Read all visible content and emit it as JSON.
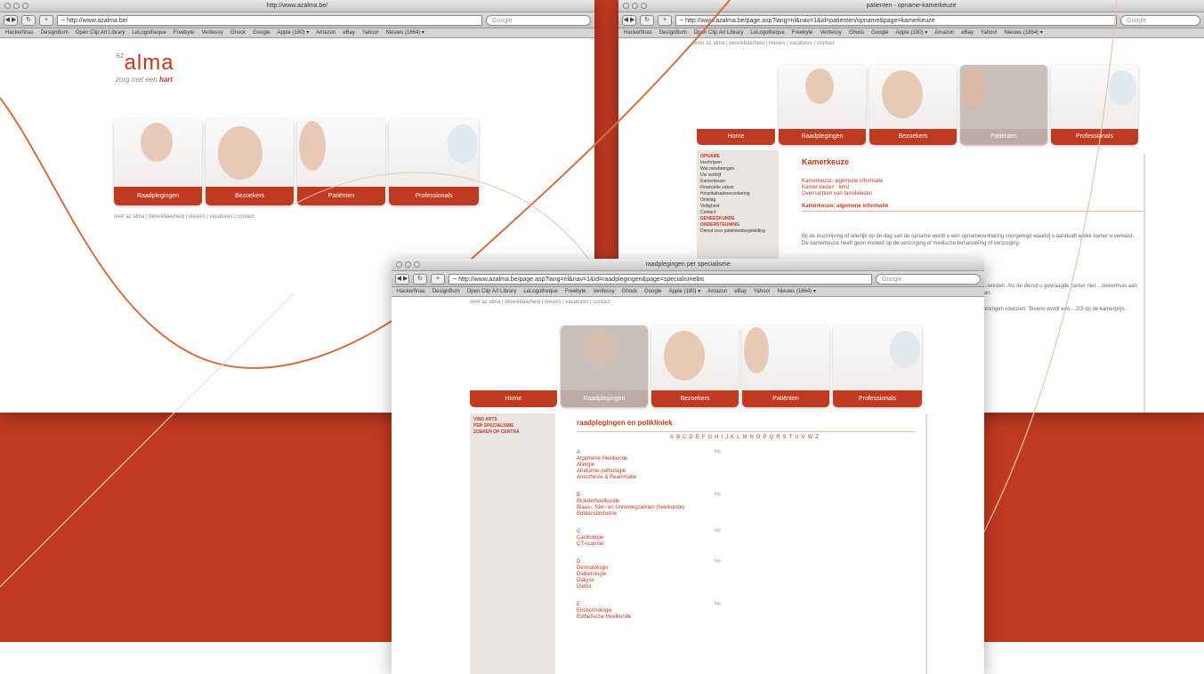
{
  "colors": {
    "accent": "#c03a22",
    "background_red": "#c03a22",
    "tab_dim": "#bcaaa4"
  },
  "bookmarks": [
    "Hackerfinas",
    "DesignBum",
    "Open Clip Art Library",
    "LeLogotheque",
    "Freebyte",
    "Veritessy",
    "Ghock",
    "Google",
    "Apple (180) ▾",
    "Amazon",
    "eBay",
    "Yahoo!",
    "Nieuws (1864) ▾"
  ],
  "search_placeholder": "Google",
  "site": {
    "logo_prefix": "az",
    "logo_name": "alma",
    "slogan_prefix": "zorg met een",
    "slogan_accent": "hart",
    "top_links": "over az alma  |  bereikbaarheid  |  nieuws  |  vacatures  |  contact"
  },
  "window1": {
    "title": "http://www.azalma.be/",
    "url": "http://www.azalma.be/",
    "tabs": [
      "Raadplegingen",
      "Bezoekers",
      "Patiënten",
      "Professionals"
    ]
  },
  "window2": {
    "title": "patienten - opname-kamerkeuze",
    "url": "http://www.azalma.be/page.asp?lang=nl&nav=1&id=patienten/opname&page=kamerkeuze",
    "tabs": [
      "Home",
      "Raadplegingen",
      "Bezoekers",
      "Patiënten",
      "Professionals"
    ],
    "sidebar": [
      "OPNAME",
      "Inschrijven",
      "Wat meebrengen",
      "Uw verblijf",
      "Kamerkeuze",
      "Financiële zaken",
      "Hospitalisatieverzekering",
      "Ontslag",
      "Veiligheid",
      "Contact",
      "GENEESKUNDE",
      "ONDERSTEUNING",
      "Dienst voor patiëntenbegeleiding"
    ],
    "heading": "Kamerkeuze",
    "links": [
      "Kamerkeuze: algemene informatie",
      "Kamer kiezen : kmd",
      "Overnachten van familieleden"
    ],
    "subheading": "Kamerkeuze: algemene informatie",
    "paragraph": "Bij de inschrijving of uiterlijk op de dag van de opname wordt u een opnameverklaring voorgelegd waarbij u aanduidt welke kamer u verkiest. De kamerkeuze heeft geen invloed op de verzorging of medische behandeling of verzorging.",
    "paragraph2": "...bespreekt u in het patiëntenverblijf. Kamerbezoek ligt in de campus Eeklo. ...worden. Als de dienst u gevraagde kamer niet ...ziekenhuis aan de prijzen zijn u bij opname ...kamer ...kunt. ...aan de kamer en ...het alweg aan.",
    "paragraph3": "...Kosten en behandeling hebben ook erelonen. Voor het verblijf ...tegemoetkomingen voorzien. Tevens wordt een ...2/3 op de kamerprijs.",
    "paragraph4": "...wordt een verblijf op een"
  },
  "window3": {
    "title": "raadplegingen per specialisme",
    "url": "http://www.azalma.be/page.asp?lang=nl&nav=1&id=raadplegingen&page=specialismebis",
    "tabs": [
      "Home",
      "Raadplegingen",
      "Bezoekers",
      "Patiënten",
      "Professionals"
    ],
    "sidebar": [
      "VIND ARTS",
      "PER SPECIALISME",
      "ZOEKEN OP CENTRA"
    ],
    "heading": "raadplegingen en polikliniek",
    "alphabet": [
      "A",
      "B",
      "C",
      "D",
      "E",
      "F",
      "G",
      "H",
      "I",
      "J",
      "K",
      "L",
      "M",
      "N",
      "O",
      "P",
      "Q",
      "R",
      "S",
      "T",
      "U",
      "V",
      "W",
      "Z"
    ],
    "top_label": "top",
    "groups": [
      {
        "letter": "A",
        "items": [
          "Algemene Heelkunde",
          "Allergie",
          "Anatomie-pathologie",
          "Anesthesie & Reanimatie"
        ]
      },
      {
        "letter": "B",
        "items": [
          "Bloederheelkunde",
          "Blaas-, Nier- en Urinewegziekten (heelkunde)",
          "Botdensitometrie"
        ]
      },
      {
        "letter": "C",
        "items": [
          "Cardiologie",
          "CT-scanner"
        ]
      },
      {
        "letter": "D",
        "items": [
          "Dermatologie",
          "Diabetologie",
          "Dialyse",
          "Dietist"
        ]
      },
      {
        "letter": "E",
        "items": [
          "Endocrinologie",
          "Esthetische Heelkunde"
        ]
      }
    ]
  }
}
